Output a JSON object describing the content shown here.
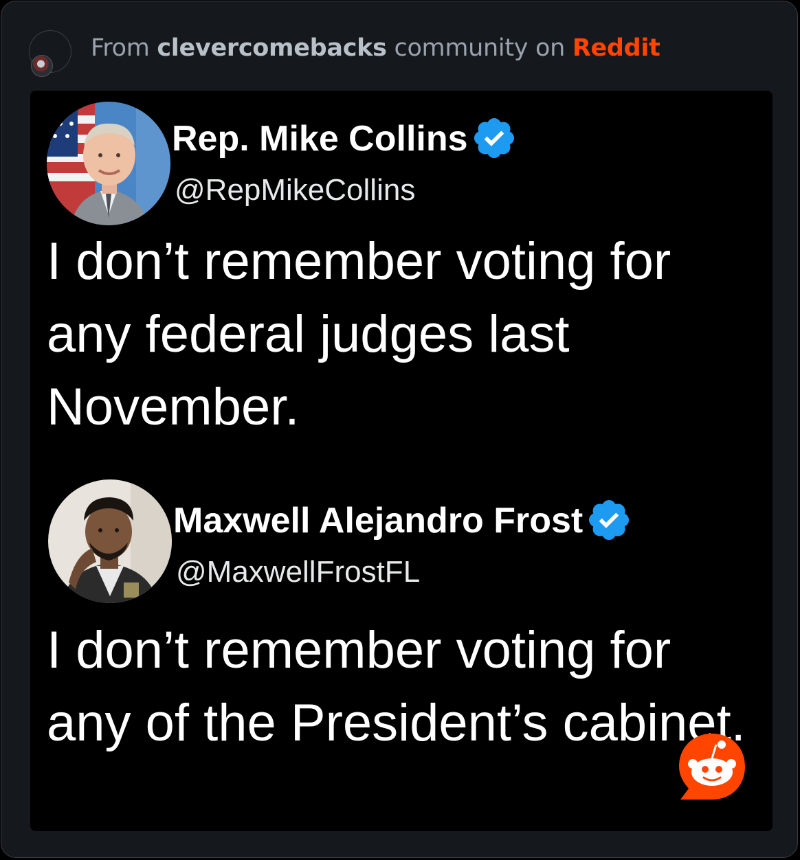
{
  "header": {
    "prefix": "From ",
    "community": "clevercomebacks",
    "middle": " community on ",
    "platform": "Reddit"
  },
  "tweets": [
    {
      "name": "Rep. Mike Collins",
      "handle": "@RepMikeCollins",
      "text": "I don’t remember voting for any federal judges last November."
    },
    {
      "name": "Maxwell Alejandro Frost",
      "handle": "@MaxwellFrostFL",
      "text": "I don’t remember voting for any of the President’s cabinet."
    }
  ],
  "icons": {
    "verified": "verified-badge-icon",
    "reddit": "reddit-snoo-icon",
    "community": "community-avatar"
  },
  "colors": {
    "card_bg": "#15181d",
    "post_bg": "#000000",
    "reddit_orange": "#ff4500",
    "verified_blue": "#1d9bf0"
  }
}
